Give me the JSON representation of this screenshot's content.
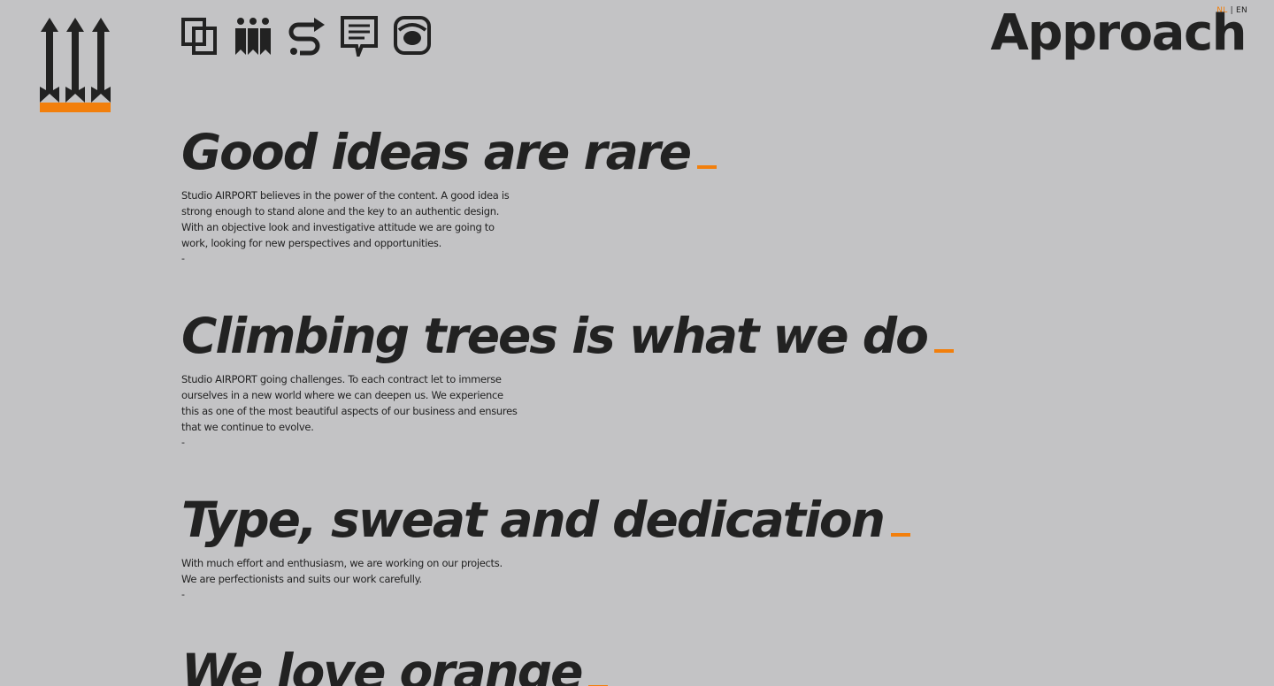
{
  "header": {
    "page_title": "Approach",
    "lang": {
      "nl": "NL",
      "separator": "|",
      "en": "EN"
    },
    "nav_icons": [
      {
        "name": "portfolio-icon"
      },
      {
        "name": "people-icon"
      },
      {
        "name": "approach-icon"
      },
      {
        "name": "news-icon"
      },
      {
        "name": "contact-phone-icon"
      }
    ]
  },
  "sections": [
    {
      "title": "Good ideas are rare",
      "text": "Studio AIRPORT believes in the power of the content. A good idea is strong enough to stand alone and the key to an authentic design. With an objective look and investigative attitude we are going to work, looking for new perspectives and opportunities.",
      "dash": "-"
    },
    {
      "title": "Climbing trees is what we do",
      "text": "Studio AIRPORT going challenges. To each contract let to immerse ourselves in a new world where we can deepen us. We experience this as one of the most beautiful aspects of our business and ensures that we continue to evolve.",
      "dash": "-"
    },
    {
      "title": "Type, sweat and dedication",
      "text": "With much effort and enthusiasm, we are working on our projects. We are perfectionists and suits our work carefully.",
      "dash": "-"
    },
    {
      "title": "We love orange",
      "text": "",
      "dash": ""
    }
  ],
  "colors": {
    "background": "#c3c3c5",
    "text": "#222222",
    "accent": "#f27f0c"
  }
}
